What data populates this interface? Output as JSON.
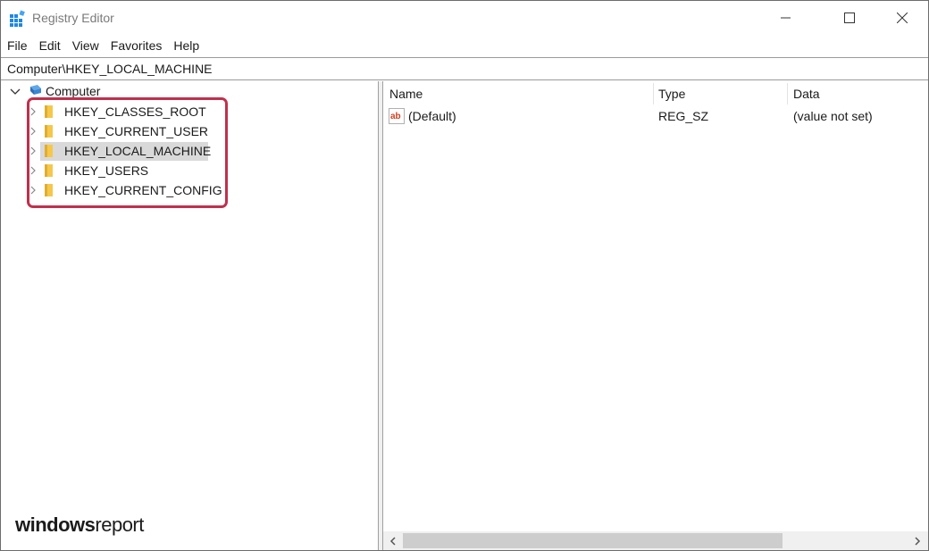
{
  "window": {
    "title": "Registry Editor"
  },
  "menu": {
    "items": [
      "File",
      "Edit",
      "View",
      "Favorites",
      "Help"
    ]
  },
  "address": {
    "path": "Computer\\HKEY_LOCAL_MACHINE"
  },
  "tree": {
    "root": "Computer",
    "keys": [
      "HKEY_CLASSES_ROOT",
      "HKEY_CURRENT_USER",
      "HKEY_LOCAL_MACHINE",
      "HKEY_USERS",
      "HKEY_CURRENT_CONFIG"
    ],
    "selected": "HKEY_LOCAL_MACHINE"
  },
  "list": {
    "columns": [
      "Name",
      "Type",
      "Data"
    ],
    "rows": [
      {
        "name": "(Default)",
        "type": "REG_SZ",
        "data": "(value not set)",
        "icon": "string-value-icon"
      }
    ]
  },
  "watermark": {
    "part1": "windows",
    "part2": "report"
  },
  "colors": {
    "highlight_border": "#c0304c",
    "selection": "#d9d9d9",
    "folder": "#f5c84c"
  }
}
